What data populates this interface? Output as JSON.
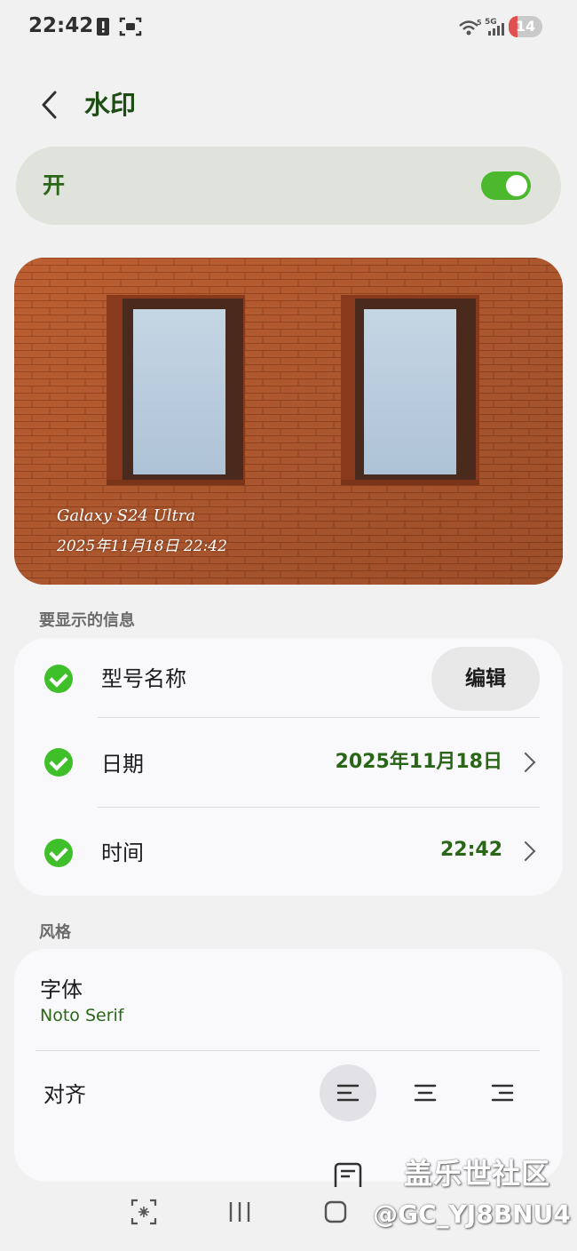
{
  "status_bar": {
    "time": "22:42",
    "battery_level": "14",
    "network_labels": [
      "5",
      "5G"
    ]
  },
  "header": {
    "title": "水印"
  },
  "toggle": {
    "label": "开",
    "on": true
  },
  "preview": {
    "model_text": "Galaxy S24 Ultra",
    "datetime_text": "2025年11月18日 22:42"
  },
  "info_section": {
    "label": "要显示的信息",
    "rows": [
      {
        "label": "型号名称",
        "checked": true,
        "button": "编辑"
      },
      {
        "label": "日期",
        "checked": true,
        "value": "2025年11月18日"
      },
      {
        "label": "时间",
        "checked": true,
        "value": "22:42"
      }
    ]
  },
  "style_section": {
    "label": "风格",
    "font_label": "字体",
    "font_value": "Noto Serif",
    "align_label": "对齐",
    "align_options": [
      "left",
      "center",
      "right"
    ],
    "align_selected": "left"
  },
  "overlay_watermark": {
    "line1": "盖乐世社区",
    "line2": "@GC_YJ8BNU4"
  },
  "colors": {
    "accent": "#2a6618",
    "switch_on": "#4bb82e",
    "check": "#3fbf2a",
    "brick": "#b85c30"
  },
  "nav_icons": [
    "capture-icon",
    "recents-icon",
    "home-icon"
  ]
}
